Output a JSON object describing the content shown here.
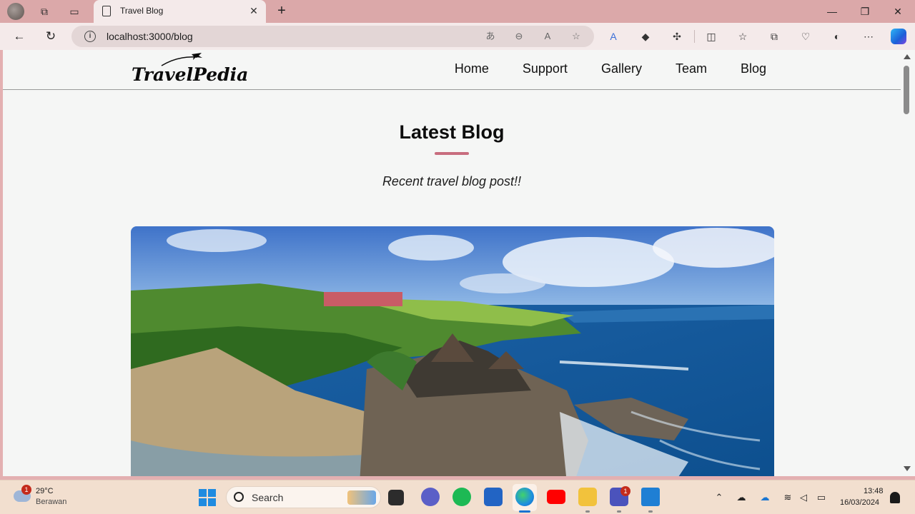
{
  "browser": {
    "tab_title": "Travel Blog",
    "url": "localhost:3000/blog"
  },
  "site": {
    "logo_text": "TravelPedia",
    "nav": [
      "Home",
      "Support",
      "Gallery",
      "Team",
      "Blog"
    ],
    "heading": "Latest Blog",
    "subheading": "Recent travel blog post!!",
    "accent_color": "#c86d7e"
  },
  "taskbar": {
    "weather_temp": "29°C",
    "weather_condition": "Berawan",
    "weather_badge": "1",
    "search_label": "Search",
    "teams_badge": "1",
    "time": "13:48",
    "date": "16/03/2024"
  }
}
